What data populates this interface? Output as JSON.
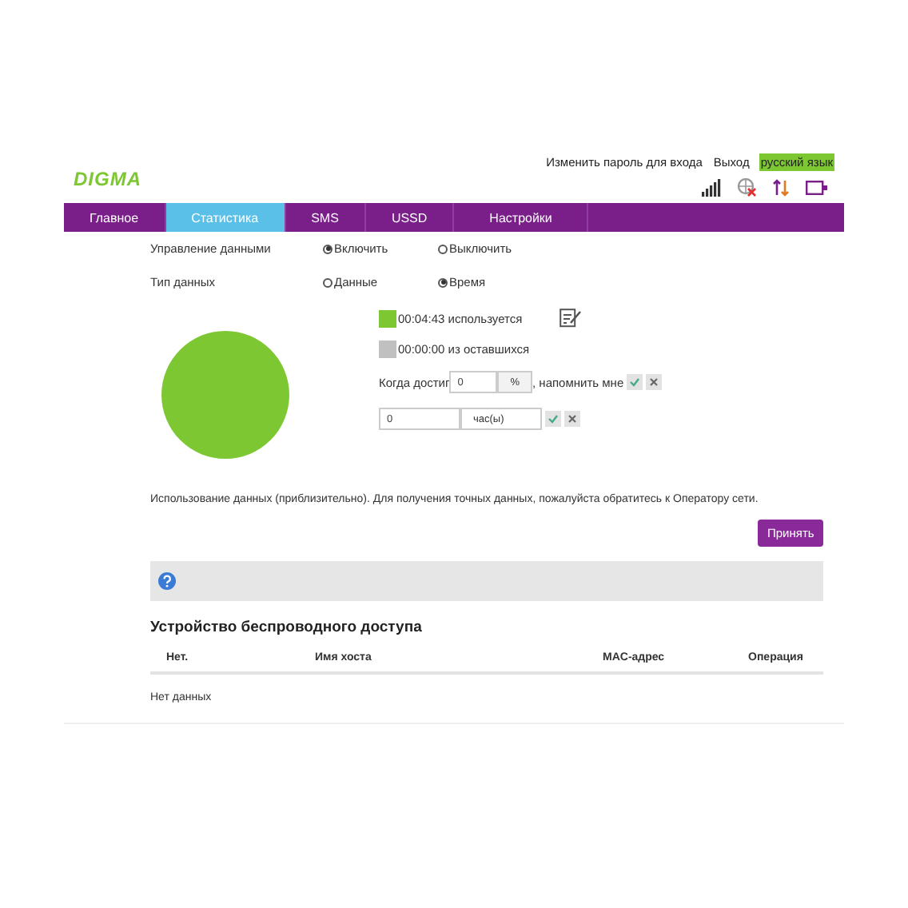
{
  "header": {
    "logo": "DIGMA",
    "links": [
      {
        "label": "Изменить пароль для входа",
        "highlighted": false
      },
      {
        "label": "Выход",
        "highlighted": false
      },
      {
        "label": "русский язык",
        "highlighted": true
      }
    ]
  },
  "tabs": [
    {
      "label": "Главное",
      "selected": false
    },
    {
      "label": "Статистика",
      "selected": true
    },
    {
      "label": "SMS",
      "selected": false
    },
    {
      "label": "USSD",
      "selected": false
    },
    {
      "label": "Настройки",
      "selected": false
    }
  ],
  "settings": [
    {
      "label": "Управление данными",
      "options": [
        {
          "label": "Включить",
          "selected": true
        },
        {
          "label": "Выключить",
          "selected": false
        }
      ]
    },
    {
      "label": "Тип данных",
      "options": [
        {
          "label": "Данные",
          "selected": false
        },
        {
          "label": "Время",
          "selected": true
        }
      ]
    }
  ],
  "legend": [
    {
      "label": "00:04:43 используется",
      "color": "#7dc832"
    },
    {
      "label": "00:00:00 из оставшихся",
      "color": "#c0c0c0"
    }
  ],
  "reminder": {
    "prefix": "Когда достиг",
    "percent_value": "0",
    "percent_unit": "%",
    "suffix": ", напомнить мне",
    "time_value": "0",
    "time_unit": "час(ы)"
  },
  "note": "Использование данных (приблизительно). Для получения точных данных, пожалуйста обратитесь к Оператору сети.",
  "apply_button": "Принять",
  "devices": {
    "title": "Устройство беспроводного доступа",
    "columns": [
      "Нет.",
      "Имя хоста",
      "MAC-адрес",
      "Операция"
    ],
    "empty": "Нет данных"
  }
}
